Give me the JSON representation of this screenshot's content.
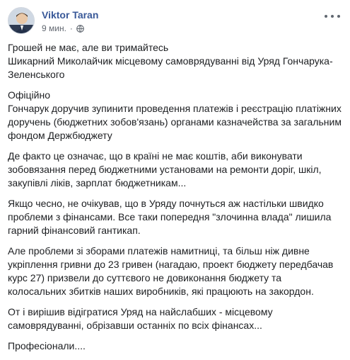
{
  "post": {
    "author": "Viktor Taran",
    "timestamp": "9 мин.",
    "privacy_icon": "globe-icon",
    "more_icon": "more-options-icon",
    "paragraphs": [
      "Грошей не має, але ви тримайтесь",
      "Шикарний Миколайчик місцевому самоврядуванні від Уряд Гончарука-Зеленського",
      "Офіційно",
      "Гончарук доручив зупинити проведення платежів і реєстрацію платіжних доручень (бюджетних зобов'язань) органами казначейства за загальним фондом Держбюджету",
      "Де факто це означає, що в країні не має коштів, аби виконувати зобовязання перед бюджетними установами на ремонти доріг, шкіл, закупівлі ліків, зарплат бюджетникам...",
      "Якщо чесно, не очікував, що в Уряду почнуться аж настільки швидко проблеми з фінансами. Все таки попередня \"злочинна влада\" лишила гарний фінансовий гантикап.",
      "Але проблеми зі зборами платежів намитниці, та більш ніж дивне укріплення гривни до 23 гривен (нагадаю, проект бюджету передбачав курс 27) призвели до суттєвого не довиконання бюджету та колосальних збитків наших виробників, які працюють на закордон.",
      "От і вирішив відігратися Уряд на найслабших - місцевому самоврядуванні, обрізавши останніх по всіх фінансах...",
      "Професіонали...."
    ]
  }
}
